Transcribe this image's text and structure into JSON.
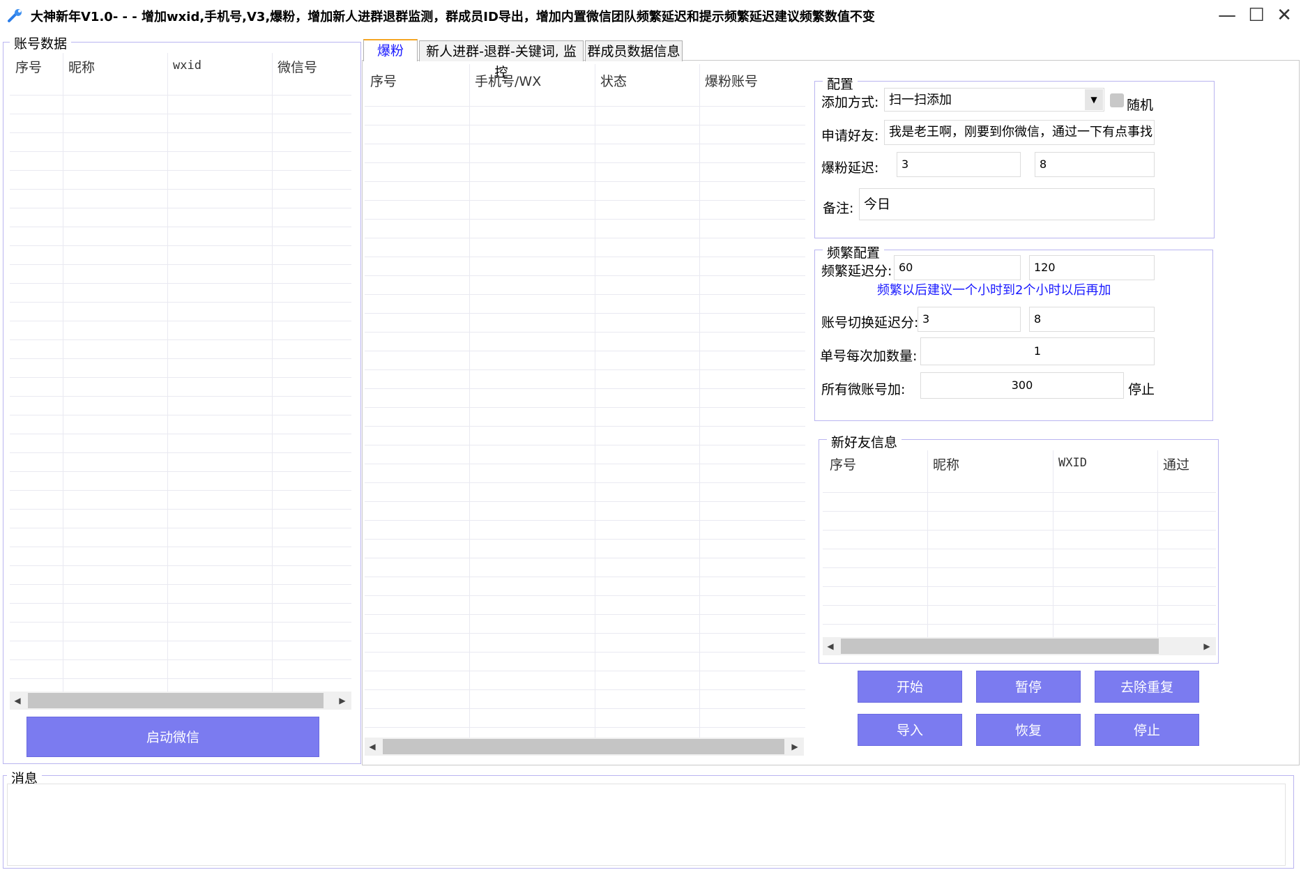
{
  "window": {
    "title": "大神新年V1.0- - - 增加wxid,手机号,V3,爆粉，增加新人进群退群监测，群成员ID导出，增加内置微信团队频繁延迟和提示频繁延迟建议频繁数值不变",
    "minimize": "—",
    "maximize": "☐",
    "close": "✕"
  },
  "accounts": {
    "legend": "账号数据",
    "columns": [
      "序号",
      "昵称",
      "wxid",
      "微信号"
    ],
    "launch_button": "启动微信"
  },
  "tabs": [
    "爆粉",
    "新人进群-退群-关键词, 监控",
    "群成员数据信息"
  ],
  "main_table": {
    "columns": [
      "序号",
      "手机号/WX",
      "状态",
      "爆粉账号"
    ]
  },
  "config": {
    "legend": "配置",
    "add_method_label": "添加方式:",
    "add_method_value": "扫一扫添加",
    "random_label": "随机",
    "request_label": "申请好友:",
    "request_value": "我是老王啊，刚要到你微信，通过一下有点事找",
    "delay_label": "爆粉延迟:",
    "delay_min": "3",
    "delay_max": "8",
    "remark_label": "备注:",
    "remark_value": "今日"
  },
  "frequency": {
    "legend": "频繁配置",
    "freq_delay_label": "频繁延迟分:",
    "freq_delay_min": "60",
    "freq_delay_max": "120",
    "hint": "频繁以后建议一个小时到2个小时以后再加",
    "switch_delay_label": "账号切换延迟分:",
    "switch_delay_min": "3",
    "switch_delay_max": "8",
    "per_add_label": "单号每次加数量:",
    "per_add_value": "1",
    "all_add_label": "所有微账号加:",
    "all_add_value": "300",
    "all_add_suffix": "停止"
  },
  "new_friends": {
    "legend": "新好友信息",
    "columns": [
      "序号",
      "昵称",
      "WXID",
      "通过"
    ]
  },
  "buttons": {
    "start": "开始",
    "pause": "暂停",
    "dedupe": "去除重复",
    "import": "导入",
    "resume": "恢复",
    "stop": "停止"
  },
  "messages": {
    "legend": "消息"
  },
  "colors": {
    "accent_button": "#7b7bf0",
    "group_border": "#b9b4f0",
    "hint_text": "#1a1aff",
    "tab_active_top": "#f5a623"
  }
}
